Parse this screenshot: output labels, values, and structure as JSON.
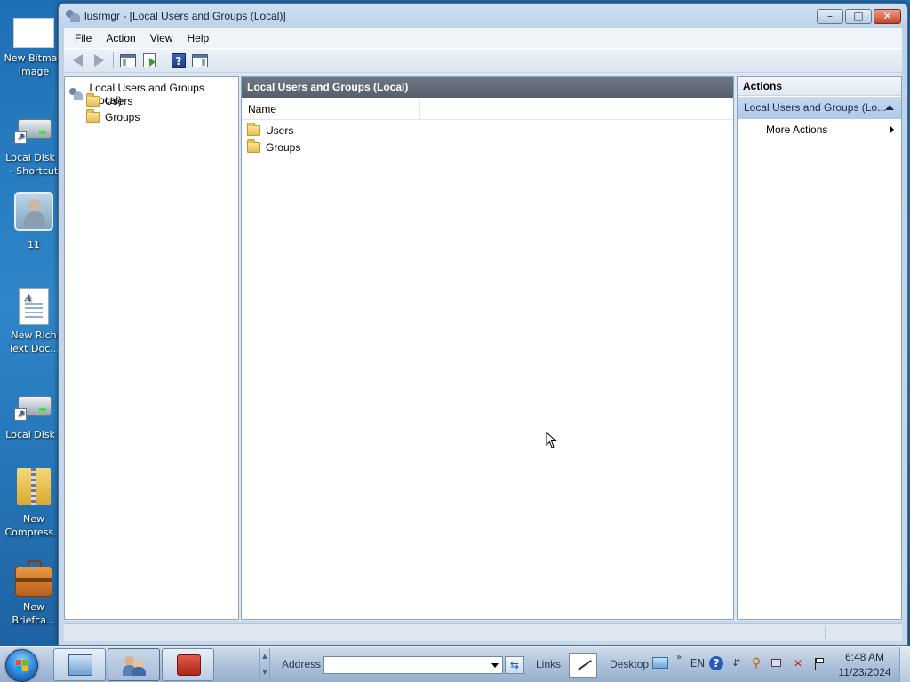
{
  "desktop": {
    "icons": [
      {
        "label": "New Bitmap\nImage",
        "icon": "bitmap-image-icon"
      },
      {
        "label": "Local Disk (\n- Shortcut",
        "icon": "local-disk-shortcut-icon"
      },
      {
        "label": "11",
        "icon": "user-account-icon"
      },
      {
        "label": "New Rich\nText Doc...",
        "icon": "rich-text-document-icon"
      },
      {
        "label": "Local Disk (",
        "icon": "local-disk-shortcut-icon"
      },
      {
        "label": "New\nCompress...",
        "icon": "compressed-folder-icon"
      },
      {
        "label": "New Briefca...",
        "icon": "briefcase-icon"
      }
    ]
  },
  "window": {
    "title": "lusrmgr - [Local Users and Groups (Local)]",
    "caption_buttons": {
      "minimize": "–",
      "maximize": "□",
      "close": "✕"
    },
    "menu": [
      "File",
      "Action",
      "View",
      "Help"
    ],
    "toolbar": {
      "help_glyph": "?",
      "buttons": [
        "back-icon",
        "forward-icon",
        "show-hide-console-tree-icon",
        "export-list-icon",
        "help-icon",
        "show-hide-action-pane-icon"
      ]
    }
  },
  "tree": {
    "root": "Local Users and Groups (Local)",
    "children": [
      "Users",
      "Groups"
    ]
  },
  "center": {
    "header": "Local Users and Groups (Local)",
    "columns": [
      "Name"
    ],
    "rows": [
      "Users",
      "Groups"
    ]
  },
  "actions": {
    "title": "Actions",
    "section": "Local Users and Groups (Lo...",
    "items": [
      "More Actions"
    ]
  },
  "taskbar": {
    "address_label": "Address",
    "address_value": "",
    "links_label": "Links",
    "desktop_label": "Desktop",
    "go_glyph": "⇆",
    "language": "EN",
    "time": "6:48 AM",
    "date": "11/23/2024",
    "help_glyph": "?",
    "scroll_up_glyph": "▲",
    "scroll_down_glyph": "▼",
    "tray_icons": [
      "desktop-toolbar-icon",
      "expand-chevron-icon",
      "language-indicator",
      "help-icon",
      "search-icon",
      "network-icon",
      "volume-muted-icon",
      "action-center-flag-icon"
    ]
  }
}
